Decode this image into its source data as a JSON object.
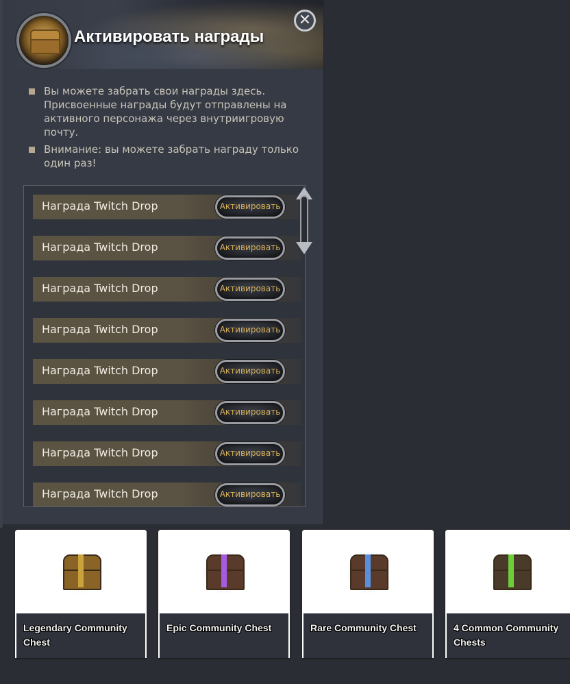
{
  "dialog": {
    "title": "Активировать награды",
    "close_symbol": "✕",
    "info": [
      "Вы можете забрать свои награды здесь. Присвоенные награды будут отправлены на активного персонажа через внутриигровую почту.",
      "Внимание: вы можете забрать награду только один раз!"
    ]
  },
  "rewards": [
    {
      "label": "Награда Twitch Drop",
      "button": "Активировать"
    },
    {
      "label": "Награда Twitch Drop",
      "button": "Активировать"
    },
    {
      "label": "Награда Twitch Drop",
      "button": "Активировать"
    },
    {
      "label": "Награда Twitch Drop",
      "button": "Активировать"
    },
    {
      "label": "Награда Twitch Drop",
      "button": "Активировать"
    },
    {
      "label": "Награда Twitch Drop",
      "button": "Активировать"
    },
    {
      "label": "Награда Twitch Drop",
      "button": "Активировать"
    },
    {
      "label": "Награда Twitch Drop",
      "button": "Активировать"
    }
  ],
  "cards": [
    {
      "label": "Legendary Community Chest",
      "color": "#c9a23c",
      "accent": "#8a6427"
    },
    {
      "label": "Epic Community Chest",
      "color": "#a65be0",
      "accent": "#5a3a2a"
    },
    {
      "label": "Rare Community Chest",
      "color": "#5a8fe0",
      "accent": "#5a3a2a"
    },
    {
      "label": "4 Common Community Chests",
      "color": "#6ccf3a",
      "accent": "#4a3a2a"
    }
  ]
}
